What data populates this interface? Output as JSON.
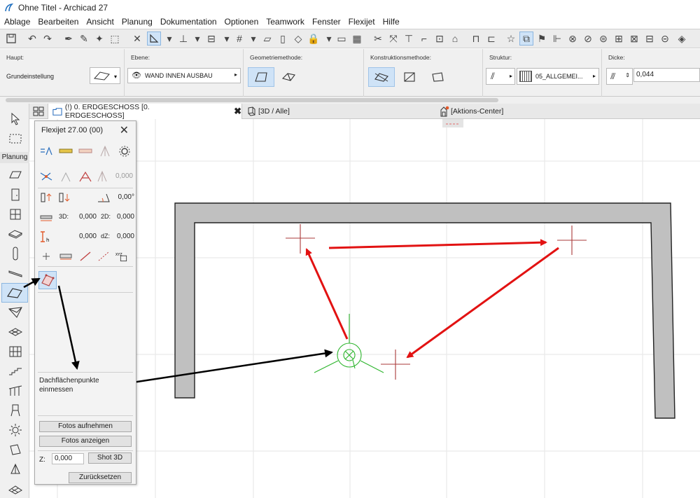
{
  "window": {
    "title": "Ohne Titel - Archicad 27"
  },
  "menu": [
    "Ablage",
    "Bearbeiten",
    "Ansicht",
    "Planung",
    "Dokumentation",
    "Optionen",
    "Teamwork",
    "Fenster",
    "Flexijet",
    "Hilfe"
  ],
  "infobox": {
    "haupt_label": "Haupt:",
    "haupt_value": "Grundeinstellung",
    "ebene_label": "Ebene:",
    "ebene_value": "WAND INNEN AUSBAU",
    "geometrie_label": "Geometriemethode:",
    "konstruktion_label": "Konstruktionsmethode:",
    "struktur_label": "Struktur:",
    "struktur_value": "05_ALLGEMEI...",
    "dicke_label": "Dicke:",
    "dicke_value": "0,044"
  },
  "tabs": [
    {
      "label": "(!) 0. ERDGESCHOSS [0. ERDGESCHOSS]",
      "close": "✖"
    },
    {
      "label": "[3D / Alle]"
    },
    {
      "label": "[Aktions-Center]"
    }
  ],
  "toolbox": {
    "group_label": "Planung",
    "tools": [
      "arrow",
      "marquee",
      "wall",
      "door",
      "window",
      "slab",
      "column",
      "beam",
      "roof",
      "mesh",
      "shell",
      "curtain-wall",
      "stair",
      "railing",
      "object",
      "lamp",
      "zone",
      "morph"
    ]
  },
  "palette": {
    "title": "Flexijet 27.00 (00)",
    "close": "✕",
    "row2_value": "0,000",
    "angle_value": "0,00°",
    "label_3d": "3D:",
    "value_3d": "0,000",
    "label_2d": "2D:",
    "value_2d": "0,000",
    "value_h": "0,000",
    "label_dz": "dZ:",
    "value_dz": "0,000",
    "description": "Dachflächenpunkte einmessen",
    "btn_fotos_aufnehmen": "Fotos aufnehmen",
    "btn_fotos_anzeigen": "Fotos anzeigen",
    "z_label": "Z:",
    "z_value": "0,000",
    "btn_shot3d": "Shot 3D",
    "btn_zuruecksetzen": "Zurücksetzen"
  },
  "colors": {
    "accent_active": "#cfe3f7",
    "annotation_red": "#e21212",
    "annotation_black": "#000000",
    "cursor_green": "#2db52d",
    "wall_fill": "#c0c0c0"
  }
}
